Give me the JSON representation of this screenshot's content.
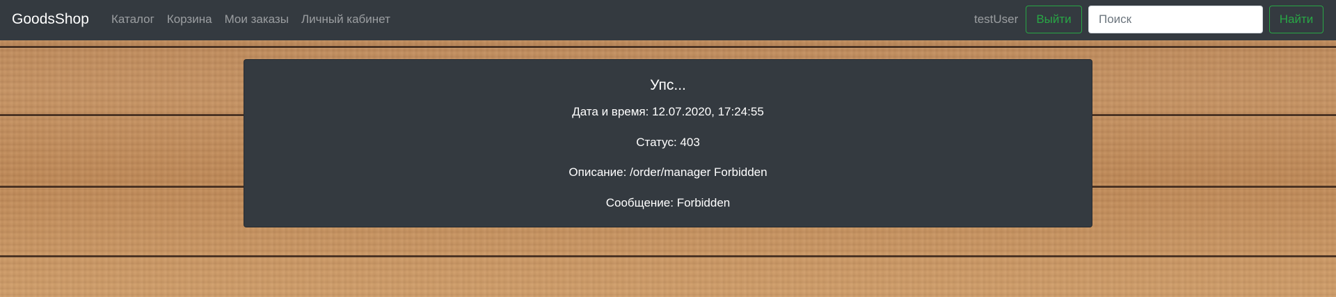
{
  "navbar": {
    "brand": "GoodsShop",
    "links": [
      "Каталог",
      "Корзина",
      "Мои заказы",
      "Личный кабинет"
    ],
    "username": "testUser",
    "logout_label": "Выйти",
    "search_placeholder": "Поиск",
    "search_label": "Найти"
  },
  "error": {
    "title": "Упс...",
    "datetime": "Дата и время: 12.07.2020, 17:24:55",
    "status": "Статус: 403",
    "description": "Описание: /order/manager Forbidden",
    "message": "Сообщение: Forbidden"
  },
  "colors": {
    "navbar_bg": "#343a40",
    "accent_green": "#28a745",
    "card_bg": "#343a40"
  }
}
